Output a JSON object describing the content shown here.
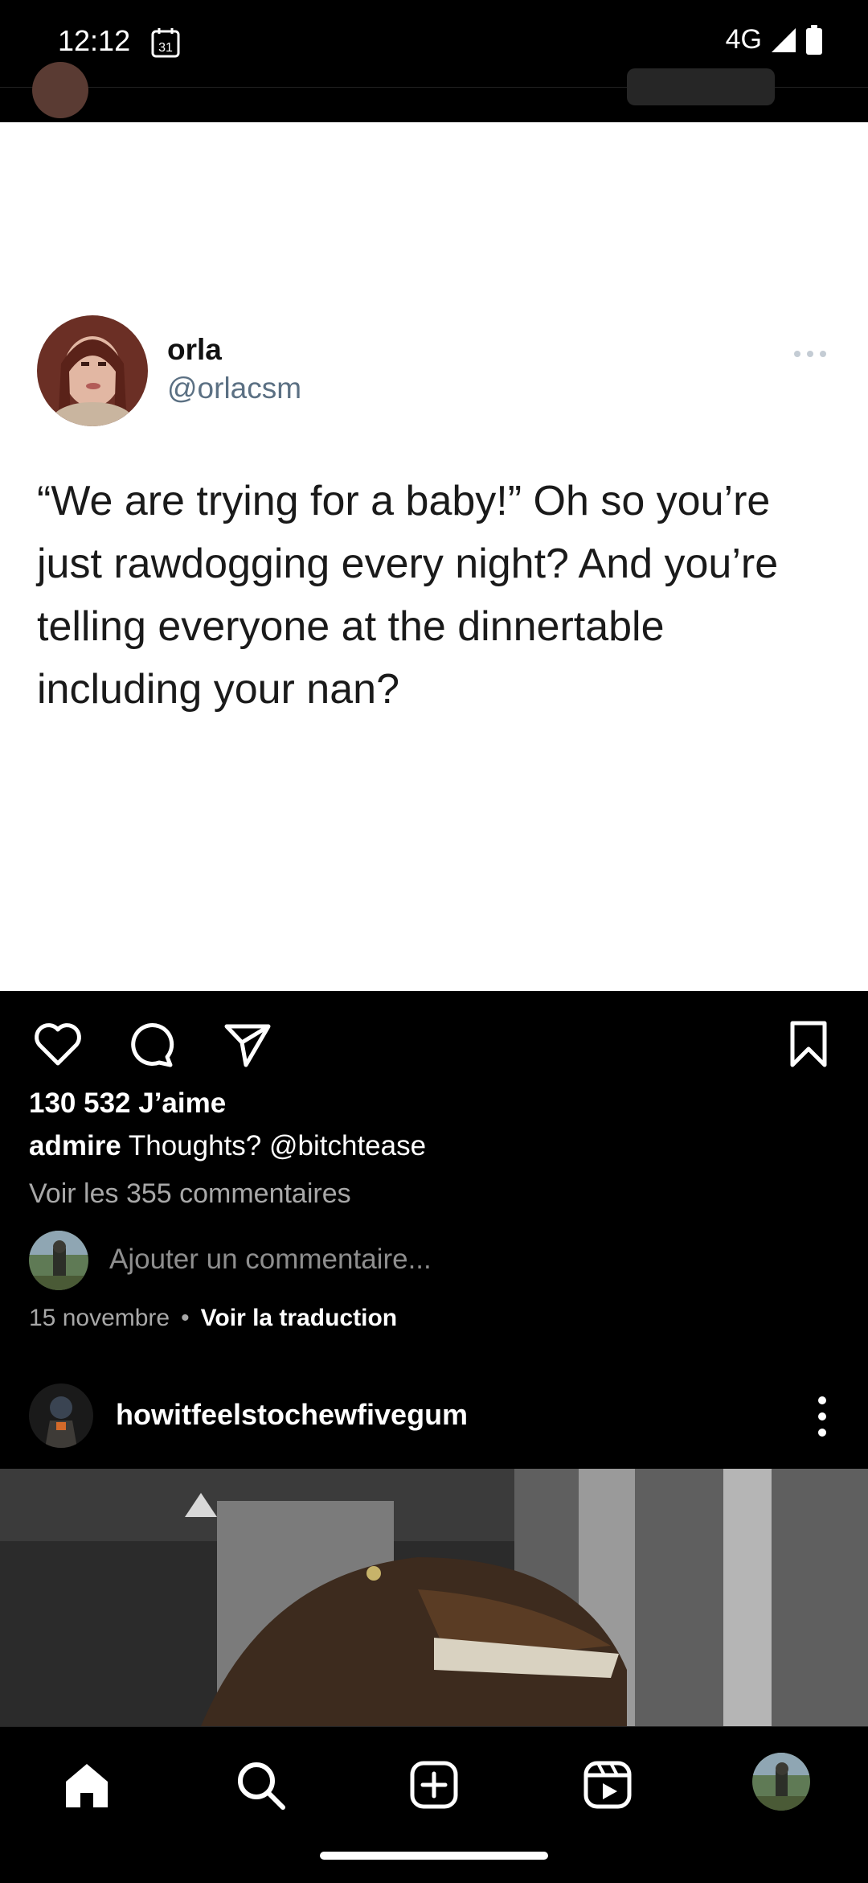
{
  "status_bar": {
    "time": "12:12",
    "calendar_day": "31",
    "network": "4G"
  },
  "post": {
    "tweet": {
      "display_name": "orla",
      "handle": "@orlacsm",
      "text": "“We are trying for a baby!” Oh so you’re just rawdogging every night? And you’re telling everyone at the dinnertable including your nan?"
    },
    "likes": "130 532 J’aime",
    "caption_user": "admire",
    "caption_text": " Thoughts? @bitchtease",
    "view_comments": "Voir les 355 commentaires",
    "comment_placeholder": "Ajouter un commentaire...",
    "date": "15 novembre",
    "separator": "•",
    "translate": "Voir la traduction"
  },
  "next_post": {
    "username": "howitfeelstochewfivegum"
  },
  "icons": {
    "like": "heart-icon",
    "comment": "comment-icon",
    "share": "paper-plane-icon",
    "save": "bookmark-icon",
    "home": "home-icon",
    "search": "search-icon",
    "create": "plus-square-icon",
    "reels": "reels-icon"
  },
  "colors": {
    "background": "#000000",
    "text_primary": "#ffffff",
    "text_secondary": "#a8a8a8",
    "tweet_bg": "#ffffff",
    "tweet_handle": "#5b7083"
  }
}
